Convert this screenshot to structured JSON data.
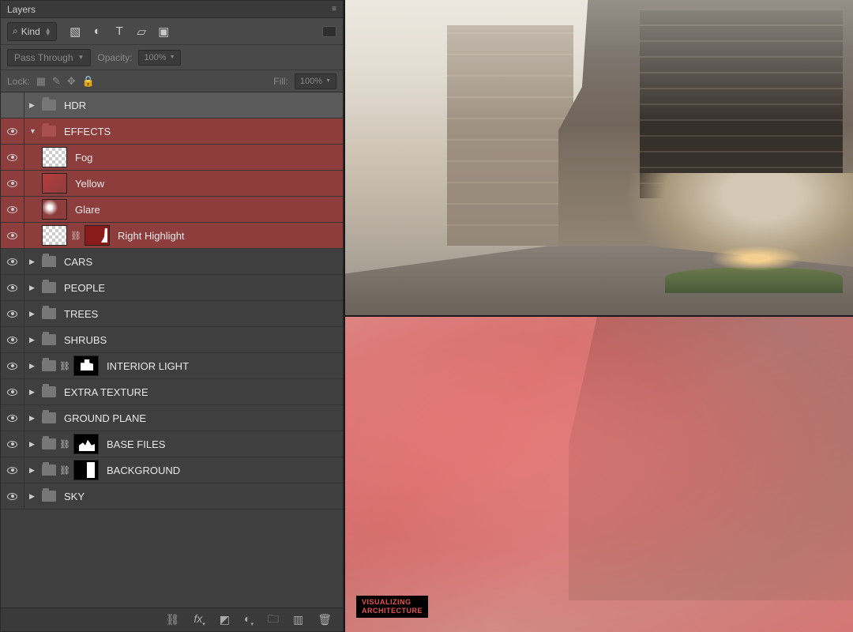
{
  "panel": {
    "title": "Layers",
    "menu_icon": "≡"
  },
  "filter": {
    "search_icon": "⌕",
    "kind": "Kind"
  },
  "blend": {
    "mode": "Pass Through",
    "opacity_label": "Opacity:",
    "opacity_val": "100%"
  },
  "lock": {
    "label": "Lock:",
    "fill_label": "Fill:",
    "fill_val": "100%"
  },
  "layers": [
    {
      "name": "HDR",
      "type": "folder",
      "vis": false,
      "sel": true,
      "tint": false,
      "exp": false,
      "indent": 0
    },
    {
      "name": "EFFECTS",
      "type": "folder",
      "vis": true,
      "sel": false,
      "tint": true,
      "exp": true,
      "indent": 0,
      "open": true
    },
    {
      "name": "Fog",
      "type": "layer",
      "vis": true,
      "tint": true,
      "thumb": "checker",
      "indent": 2
    },
    {
      "name": "Yellow",
      "type": "layer",
      "vis": true,
      "tint": true,
      "thumb": "redfade",
      "indent": 2
    },
    {
      "name": "Glare",
      "type": "layer",
      "vis": true,
      "tint": true,
      "thumb": "checker glare",
      "indent": 2
    },
    {
      "name": "Right Highlight",
      "type": "layer",
      "vis": true,
      "tint": true,
      "thumb": "checker",
      "mask": "rh",
      "link": true,
      "indent": 2
    },
    {
      "name": "CARS",
      "type": "folder",
      "vis": true,
      "exp": false,
      "indent": 0
    },
    {
      "name": "PEOPLE",
      "type": "folder",
      "vis": true,
      "exp": false,
      "indent": 0
    },
    {
      "name": "TREES",
      "type": "folder",
      "vis": true,
      "exp": false,
      "indent": 0
    },
    {
      "name": "SHRUBS",
      "type": "folder",
      "vis": true,
      "exp": false,
      "indent": 0
    },
    {
      "name": "INTERIOR LIGHT",
      "type": "folder",
      "vis": true,
      "exp": false,
      "indent": 0,
      "fmask": "mt1",
      "flink": true
    },
    {
      "name": "EXTRA TEXTURE",
      "type": "folder",
      "vis": true,
      "exp": false,
      "indent": 0
    },
    {
      "name": "GROUND PLANE",
      "type": "folder",
      "vis": true,
      "exp": false,
      "indent": 0
    },
    {
      "name": "BASE FILES",
      "type": "folder",
      "vis": true,
      "exp": false,
      "indent": 0,
      "fmask": "mt2",
      "flink": true
    },
    {
      "name": "BACKGROUND",
      "type": "folder",
      "vis": true,
      "exp": false,
      "indent": 0,
      "fmask": "mt3",
      "flink": true
    },
    {
      "name": "SKY",
      "type": "folder",
      "vis": true,
      "exp": false,
      "indent": 0
    }
  ],
  "watermark": {
    "l1": "VISUALIZING",
    "l2": "ARCHITECTURE"
  }
}
